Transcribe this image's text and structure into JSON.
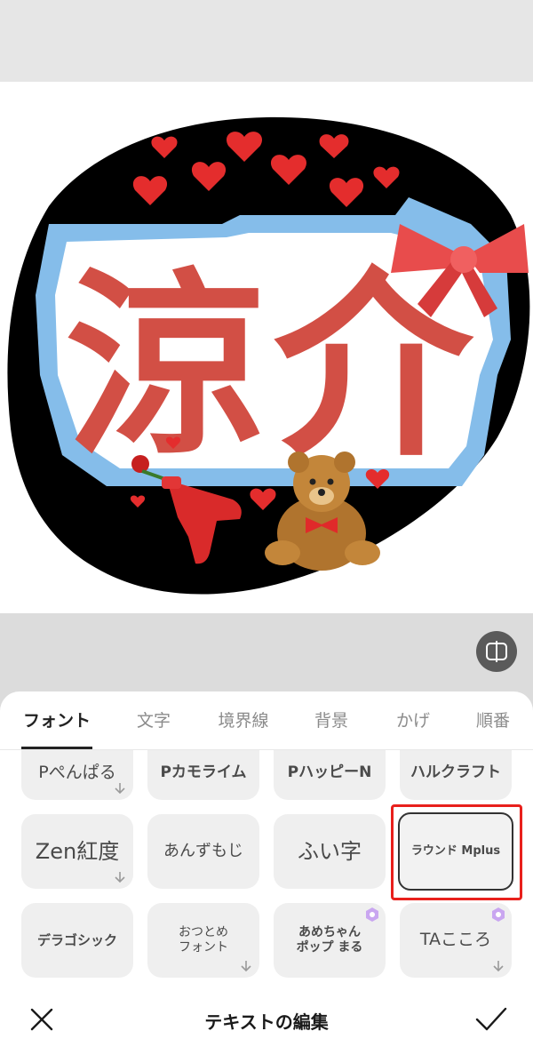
{
  "preview": {
    "main_text": "涼介",
    "text_color": "#d24f45",
    "border_color": "#85bdea",
    "background_color": "#000000"
  },
  "tabs": [
    {
      "label": "フォント",
      "active": true
    },
    {
      "label": "文字",
      "active": false
    },
    {
      "label": "境界線",
      "active": false
    },
    {
      "label": "背景",
      "active": false
    },
    {
      "label": "かげ",
      "active": false
    },
    {
      "label": "順番",
      "active": false
    }
  ],
  "fonts": {
    "r0": [
      "Pぺんぱる",
      "Pカモライム",
      "PハッピーN",
      "ハルクラフト"
    ],
    "r1": [
      "Zen紅度",
      "あんずもじ",
      "ふい字",
      "ラウンド Mplus"
    ],
    "r2": [
      "デラゴシック",
      "おつとめ\nフォント",
      "あめちゃん\nポップ まる",
      "TAこころ"
    ]
  },
  "selected_font": "ラウンド Mplus",
  "bottom_bar": {
    "title": "テキストの編集"
  },
  "colors": {
    "accent_selection": "#e8201c",
    "tile_background": "#efefef"
  }
}
